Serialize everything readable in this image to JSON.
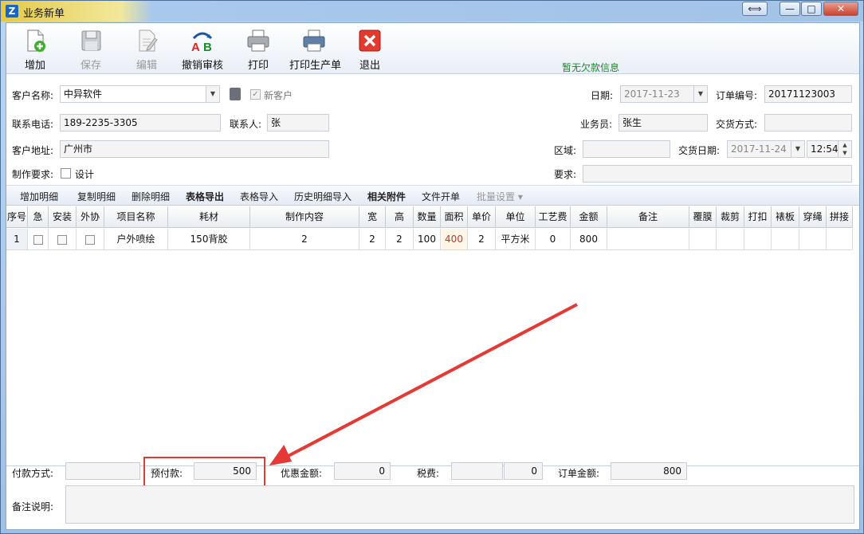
{
  "window": {
    "title": "业务新单",
    "icon": "app-logo-icon",
    "restore": "⟺",
    "minimize": "—",
    "maximize": "□",
    "close": "✕"
  },
  "toolbar": [
    {
      "name": "add",
      "label": "增加",
      "icon": "add-document-icon",
      "disabled": false
    },
    {
      "name": "save",
      "label": "保存",
      "icon": "floppy-disk-icon",
      "disabled": true
    },
    {
      "name": "edit",
      "label": "编辑",
      "icon": "edit-document-icon",
      "disabled": true
    },
    {
      "name": "revoke",
      "label": "撤销审核",
      "icon": "ab-revoke-icon",
      "disabled": false
    },
    {
      "name": "print",
      "label": "打印",
      "icon": "printer-icon",
      "disabled": false
    },
    {
      "name": "print-production",
      "label": "打印生产单",
      "icon": "printer-production-icon",
      "disabled": false
    },
    {
      "name": "exit",
      "label": "退出",
      "icon": "exit-x-icon",
      "disabled": false
    }
  ],
  "notice": "暂无欠款信息",
  "form": {
    "customer_name_label": "客户名称:",
    "customer_name": "中异软件",
    "new_customer_label": "新客户",
    "new_customer_checked": true,
    "date_label": "日期:",
    "date": "2017-11-23",
    "order_no_label": "订单编号:",
    "order_no": "20171123003",
    "phone_label": "联系电话:",
    "phone": "189-2235-3305",
    "contact_label": "联系人:",
    "contact": "张",
    "salesman_label": "业务员:",
    "salesman": "张生",
    "delivery_method_label": "交货方式:",
    "delivery_method": "",
    "address_label": "客户地址:",
    "address": "广州市",
    "region_label": "区域:",
    "region": "",
    "delivery_date_label": "交货日期:",
    "delivery_date": "2017-11-24",
    "delivery_time": "12:54",
    "requirement_label": "制作要求:",
    "design_label": "设计",
    "demand_label": "要求:",
    "demand": ""
  },
  "grid_toolbar": [
    {
      "label": "增加明细",
      "bold": false,
      "disabled": false
    },
    {
      "label": "复制明细",
      "bold": false,
      "disabled": false
    },
    {
      "label": "删除明细",
      "bold": false,
      "disabled": false
    },
    {
      "label": "表格导出",
      "bold": true,
      "disabled": false
    },
    {
      "label": "表格导入",
      "bold": false,
      "disabled": false
    },
    {
      "label": "历史明细导入",
      "bold": false,
      "disabled": false
    },
    {
      "label": "相关附件",
      "bold": true,
      "disabled": false
    },
    {
      "label": "文件开单",
      "bold": false,
      "disabled": false
    },
    {
      "label": "批量设置 ▾",
      "bold": false,
      "disabled": true
    }
  ],
  "columns": [
    "序号",
    "急",
    "安装",
    "外协",
    "项目名称",
    "耗材",
    "制作内容",
    "宽",
    "高",
    "数量",
    "面积",
    "单价",
    "单位",
    "工艺费",
    "金额",
    "备注",
    "覆膜",
    "裁剪",
    "打扣",
    "裱板",
    "穿绳",
    "拼接"
  ],
  "rows": [
    [
      "1",
      "☐",
      "☐",
      "☐",
      "户外喷绘",
      "150背胶",
      "2",
      "2",
      "2",
      "100",
      "400",
      "2",
      "平方米",
      "0",
      "800",
      "",
      "",
      "",
      "",
      "",
      "",
      ""
    ]
  ],
  "footer": {
    "payment_method_label": "付款方式:",
    "payment_method": "",
    "prepay_label": "预付款:",
    "prepay": "500",
    "discount_label": "优惠金额:",
    "discount": "0",
    "tax_label": "税费:",
    "tax_a": "",
    "tax": "0",
    "order_amount_label": "订单金额:",
    "order_amount": "800",
    "remark_label": "备注说明:",
    "remark": ""
  }
}
